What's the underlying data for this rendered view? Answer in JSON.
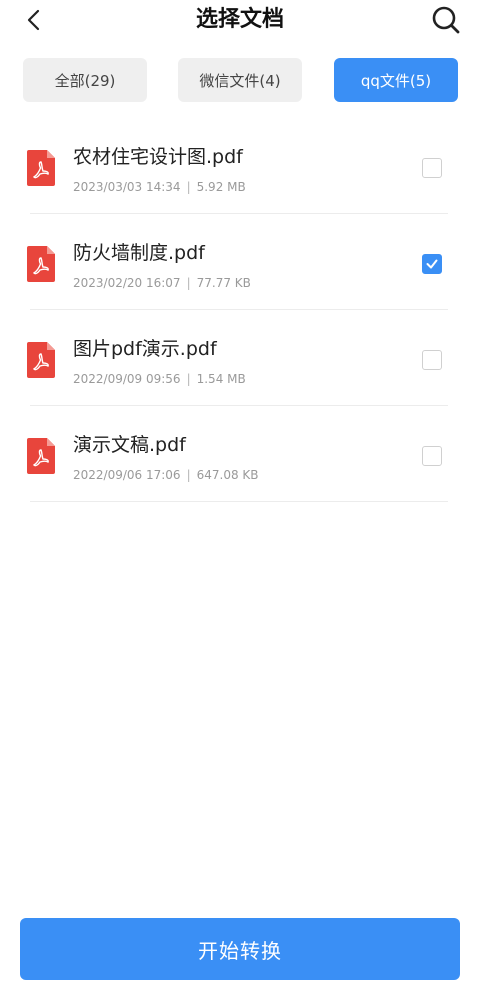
{
  "header": {
    "title": "选择文档",
    "back_icon": "chevron-left-icon",
    "search_icon": "search-icon"
  },
  "tabs": [
    {
      "label": "全部(29)",
      "active": false
    },
    {
      "label": "微信文件(4)",
      "active": false
    },
    {
      "label": "qq文件(5)",
      "active": true
    }
  ],
  "files": [
    {
      "name": "农材住宅设计图.pdf",
      "date": "2023/03/03 14:34",
      "size": "5.92 MB",
      "checked": false,
      "icon": "pdf-file-icon"
    },
    {
      "name": "防火墙制度.pdf",
      "date": "2023/02/20 16:07",
      "size": "77.77 KB",
      "checked": true,
      "icon": "pdf-file-icon"
    },
    {
      "name": "图片pdf演示.pdf",
      "date": "2022/09/09 09:56",
      "size": "1.54 MB",
      "checked": false,
      "icon": "pdf-file-icon"
    },
    {
      "name": "演示文稿.pdf",
      "date": "2022/09/06 17:06",
      "size": "647.08 KB",
      "checked": false,
      "icon": "pdf-file-icon"
    }
  ],
  "meta_separator": "|",
  "action": {
    "label": "开始转换"
  },
  "colors": {
    "accent": "#3a8ff5",
    "pdf_red": "#e8453c",
    "tab_inactive_bg": "#efefef"
  }
}
